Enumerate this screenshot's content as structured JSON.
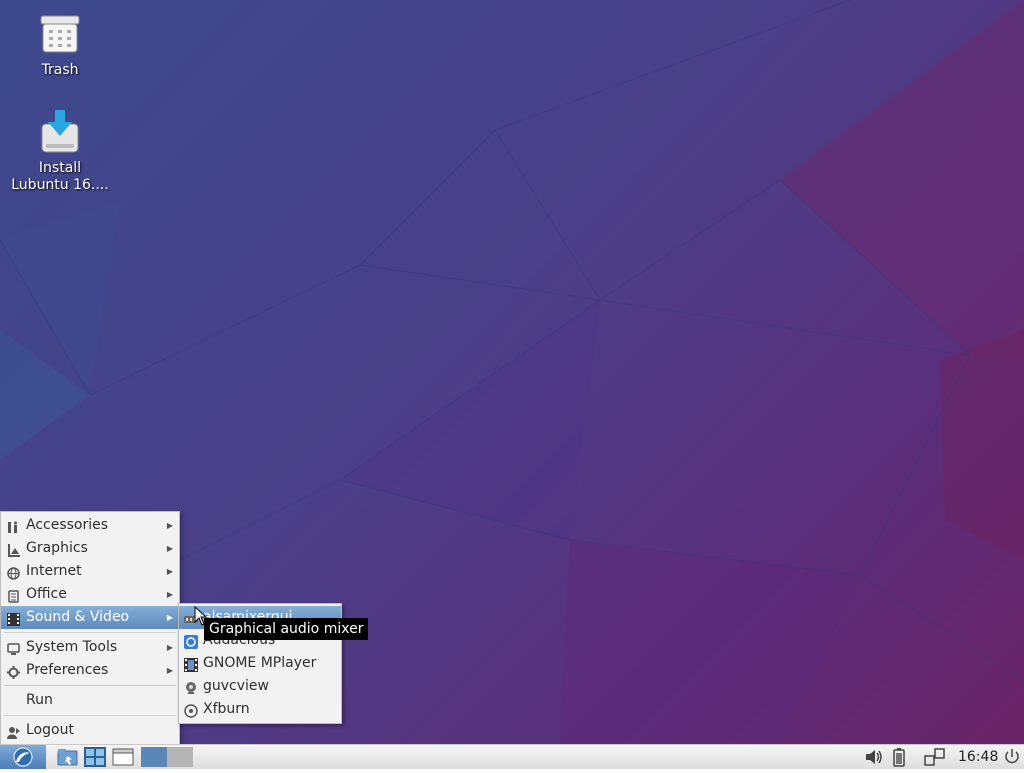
{
  "desktop": {
    "icons": [
      {
        "label": "Trash",
        "icon": "trash-icon"
      },
      {
        "label": "Install\nLubuntu 16....",
        "icon": "install-drive-icon"
      }
    ]
  },
  "main_menu": {
    "items": [
      {
        "label": "Accessories",
        "icon": "accessories-icon",
        "submenu": true
      },
      {
        "label": "Graphics",
        "icon": "graphics-icon",
        "submenu": true
      },
      {
        "label": "Internet",
        "icon": "globe-icon",
        "submenu": true
      },
      {
        "label": "Office",
        "icon": "office-icon",
        "submenu": true
      },
      {
        "label": "Sound & Video",
        "icon": "sound-video-icon",
        "submenu": true,
        "active": true
      },
      {
        "label": "System Tools",
        "icon": "monitor-icon",
        "submenu": true
      },
      {
        "label": "Preferences",
        "icon": "gear-icon",
        "submenu": true
      },
      {
        "label": "Run"
      },
      {
        "label": "Logout",
        "icon": "logout-icon"
      }
    ]
  },
  "sound_video_submenu": {
    "items": [
      {
        "label": "alsamixergui",
        "icon": "mixer-icon",
        "active": true
      },
      {
        "label": "Audacious",
        "icon": "audacious-icon"
      },
      {
        "label": "GNOME MPlayer",
        "icon": "film-icon"
      },
      {
        "label": "guvcview",
        "icon": "webcam-icon"
      },
      {
        "label": "Xfburn",
        "icon": "disc-icon"
      }
    ]
  },
  "tooltip": {
    "text": "Graphical audio mixer"
  },
  "taskbar": {
    "clock": "16:48",
    "launchers": [
      "start-menu-icon",
      "file-manager-icon",
      "desktop-switcher-icon",
      "window-icon"
    ],
    "tray": [
      "volume-icon",
      "battery-icon",
      "network-icon",
      "power-icon"
    ]
  },
  "colors": {
    "accent": "#5d8bbf",
    "desktop_bg": "#4a3f88",
    "taskbar_bg": "#e8e8e8"
  }
}
